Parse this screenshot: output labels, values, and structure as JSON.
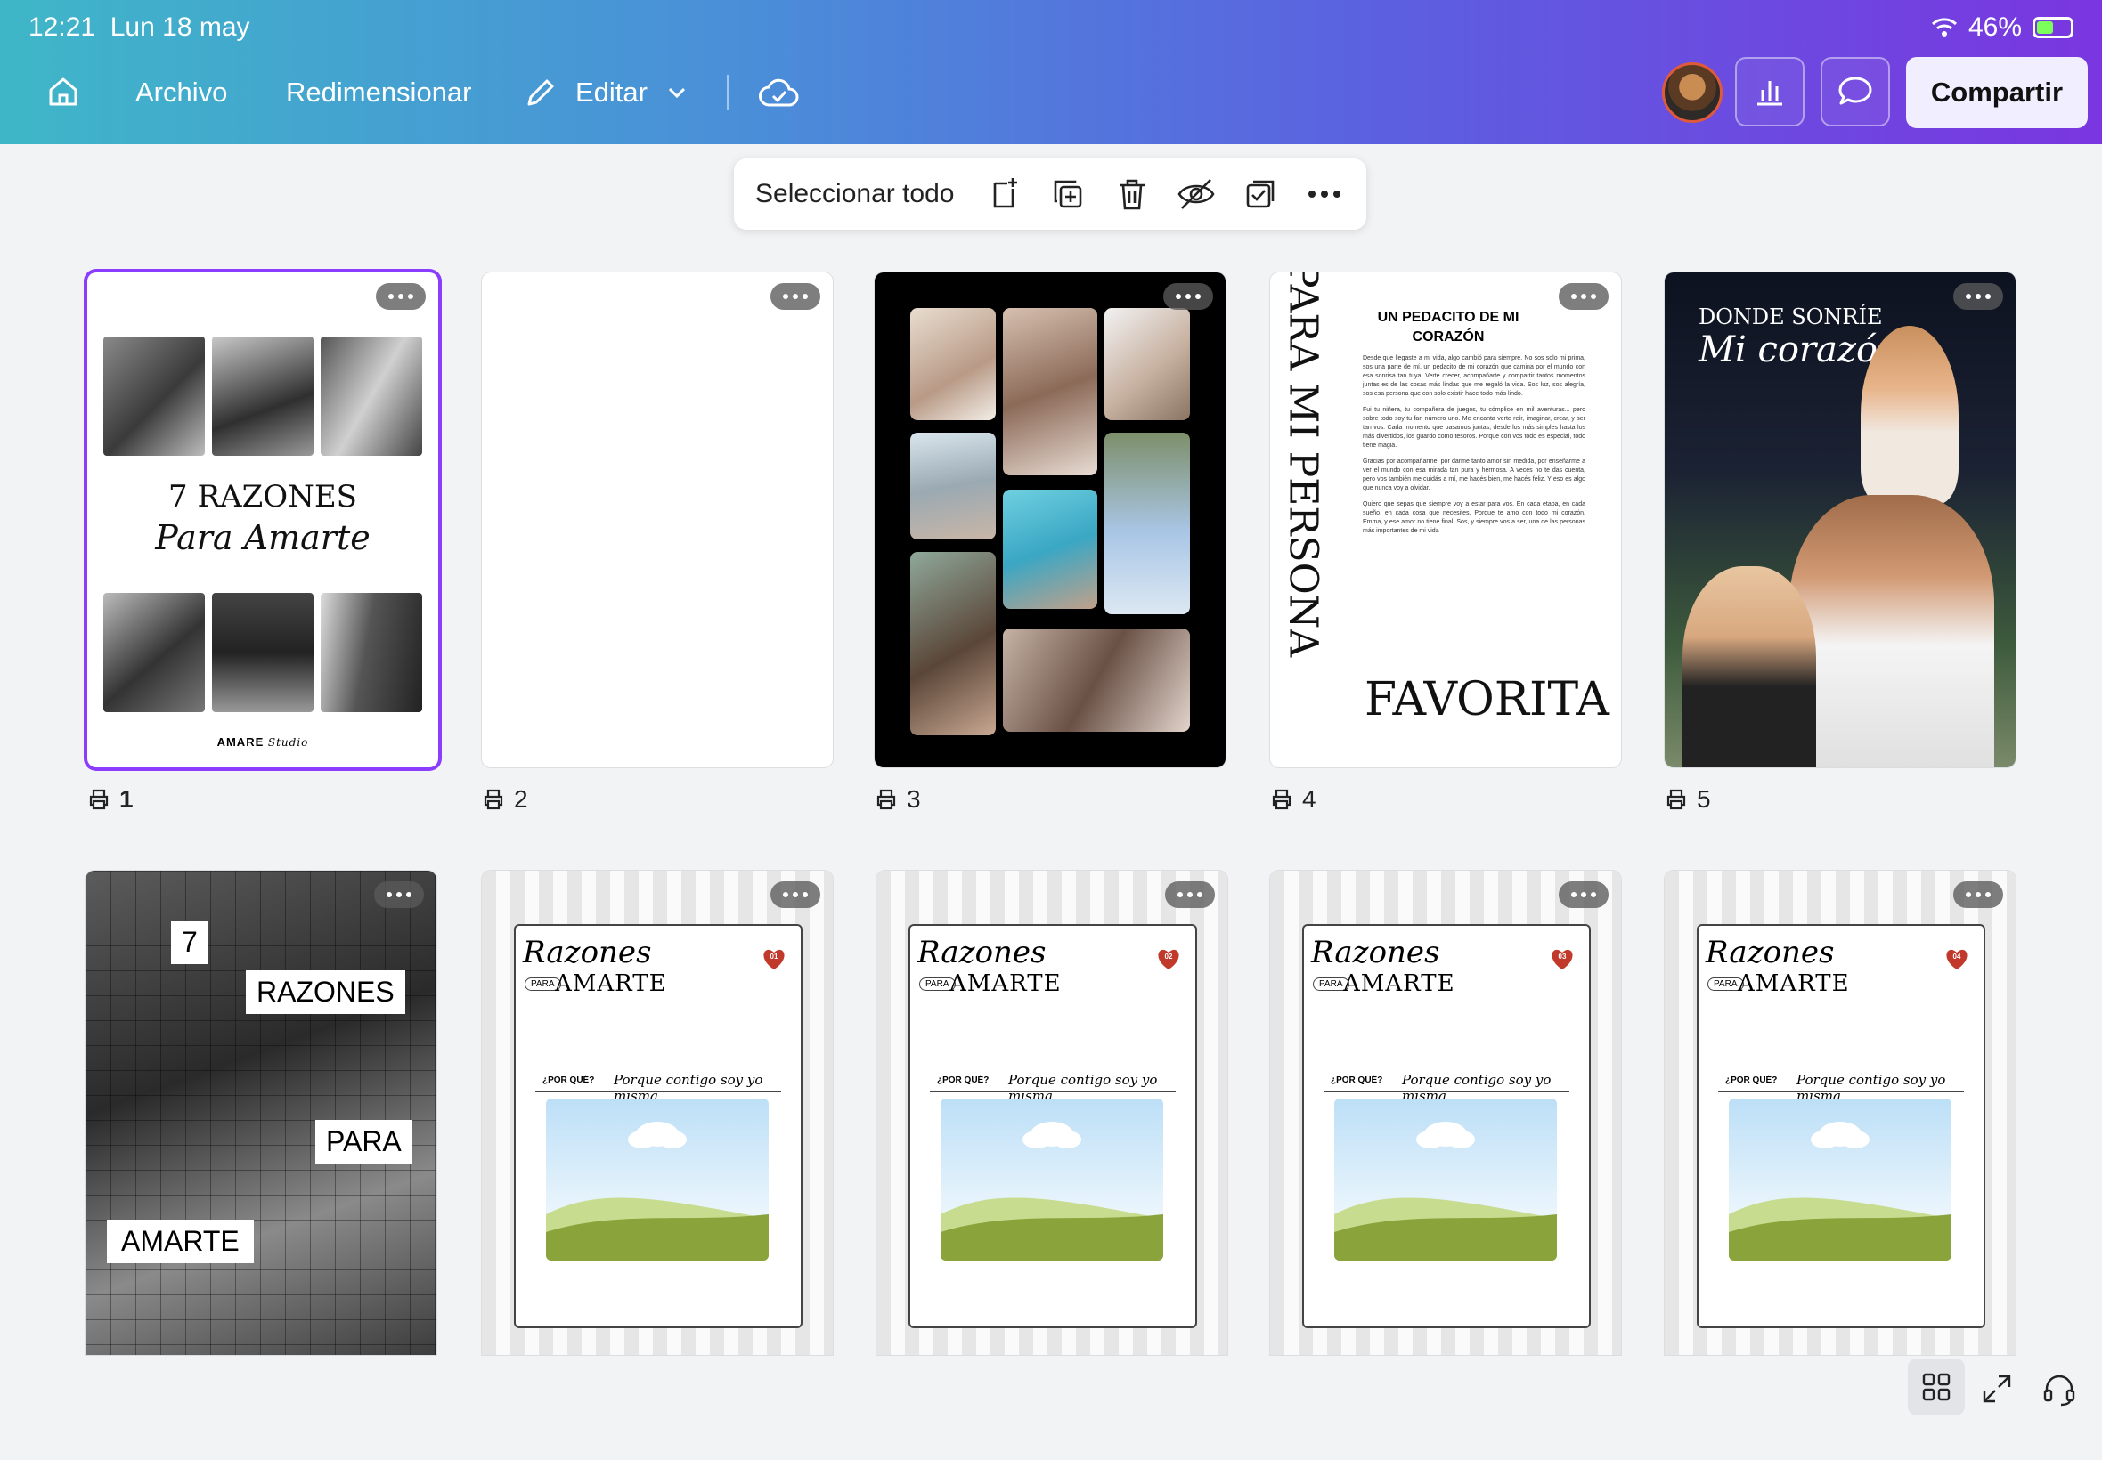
{
  "status": {
    "time": "12:21",
    "date": "Lun 18 may",
    "battery": "46%"
  },
  "nav": {
    "archivo": "Archivo",
    "redimensionar": "Redimensionar",
    "editar": "Editar",
    "share": "Compartir"
  },
  "toolbar": {
    "select_all": "Seleccionar todo"
  },
  "pages": [
    {
      "num": "1",
      "line1": "7 RAZONES",
      "line2": "Para Amarte",
      "footer_brand": "AMARE",
      "footer_script": "Studio"
    },
    {
      "num": "2"
    },
    {
      "num": "3"
    },
    {
      "num": "4",
      "heading": "UN PEDACITO DE MI CORAZÓN",
      "vertical": "PARA MI PERSONA",
      "bottom": "FAVORITA",
      "paragraphs": [
        "Desde que llegaste a mi vida, algo cambió para siempre. No sos solo mi prima, sos una parte de mí, un pedacito de mi corazón que camina por el mundo con esa sonrisa tan tuya. Verte crecer, acompañarte y compartir tantos momentos juntas es de las cosas más lindas que me regaló la vida. Sos luz, sos alegría, sos esa persona que con solo existir hace todo más lindo.",
        "Fui tu niñera, tu compañera de juegos, tu cómplice en mil aventuras... pero sobre todo soy tu fan número uno. Me encanta verte reír, imaginar, crear, y ser tan vos. Cada momento que pasamos juntas, desde los más simples hasta los más divertidos, los guardo como tesoros. Porque con vos todo es especial, todo tiene magia.",
        "Gracias por acompañarme, por darme tanto amor sin medida, por enseñarme a ver el mundo con esa mirada tan pura y hermosa. A veces no te das cuenta, pero vos también me cuidás a mí, me hacés bien, me hacés feliz. Y eso es algo que nunca voy a olvidar.",
        "Quiero que sepas que siempre voy a estar para vos. En cada etapa, en cada sueño, en cada cosa que necesites. Porque te amo con todo mi corazón, Emma, y ese amor no tiene final. Sos, y siempre vos a ser, una de las personas más importantes de mi vida"
      ]
    },
    {
      "num": "5",
      "line1": "DONDE SONRÍE",
      "line2": "Mi corazón"
    },
    {
      "words": [
        "7",
        "RAZONES",
        "PARA",
        "AMARTE"
      ]
    },
    {
      "badge": "01"
    },
    {
      "badge": "02"
    },
    {
      "badge": "03"
    },
    {
      "badge": "04"
    }
  ],
  "card": {
    "title": "Razones",
    "para": "PARA",
    "amarte": "AMARTE",
    "question": "¿POR QUÉ?",
    "answer": "Porque contigo soy yo misma"
  },
  "colors": {
    "accent": "#8b3dff",
    "heart": "#c0392b"
  },
  "icons": [
    "home-icon",
    "pencil-icon",
    "chevron-down-icon",
    "cloud-check-icon",
    "chart-icon",
    "comment-icon",
    "add-page-icon",
    "duplicate-icon",
    "trash-icon",
    "hide-icon",
    "select-check-icon",
    "more-icon",
    "printer-icon",
    "grid-view-icon",
    "fullscreen-icon",
    "headset-icon",
    "wifi-icon"
  ]
}
